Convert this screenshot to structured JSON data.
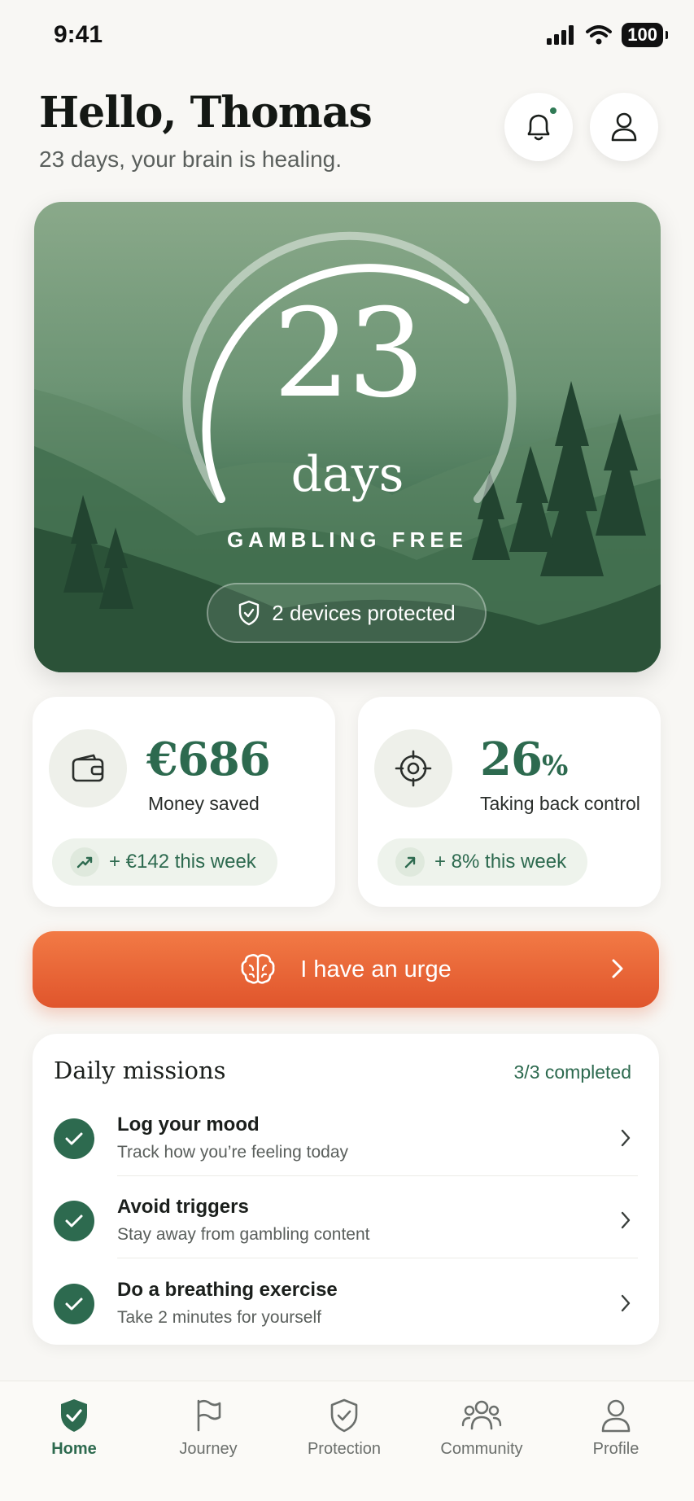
{
  "status_bar": {
    "time": "9:41",
    "battery": "100"
  },
  "header": {
    "greeting": "Hello, Thomas",
    "subtitle": "23 days, your brain is healing."
  },
  "hero": {
    "days_count": "23",
    "days_unit": "days",
    "caption": "GAMBLING FREE",
    "devices_label": "2 devices protected"
  },
  "stats": {
    "money": {
      "value": "€686",
      "label": "Money saved",
      "trend": "+ €142 this week"
    },
    "control": {
      "value": "26",
      "unit": "%",
      "label": "Taking back control",
      "trend": "+ 8% this week"
    }
  },
  "urge_button": {
    "label": "I have an urge"
  },
  "missions": {
    "title": "Daily missions",
    "progress": "3/3 completed",
    "items": [
      {
        "title": "Log your mood",
        "subtitle": "Track how you’re feeling today"
      },
      {
        "title": "Avoid triggers",
        "subtitle": "Stay away from gambling content"
      },
      {
        "title": "Do a breathing exercise",
        "subtitle": "Take 2 minutes for yourself"
      }
    ]
  },
  "tabs": [
    {
      "label": "Home",
      "icon": "shield-check-icon",
      "active": true
    },
    {
      "label": "Journey",
      "icon": "flag-icon"
    },
    {
      "label": "Protection",
      "icon": "shield-icon"
    },
    {
      "label": "Community",
      "icon": "users-icon"
    },
    {
      "label": "Profile",
      "icon": "user-icon"
    }
  ],
  "colors": {
    "accent_green": "#2d6a4f",
    "urge_orange": "#e8653a",
    "background": "#f8f7f4"
  }
}
